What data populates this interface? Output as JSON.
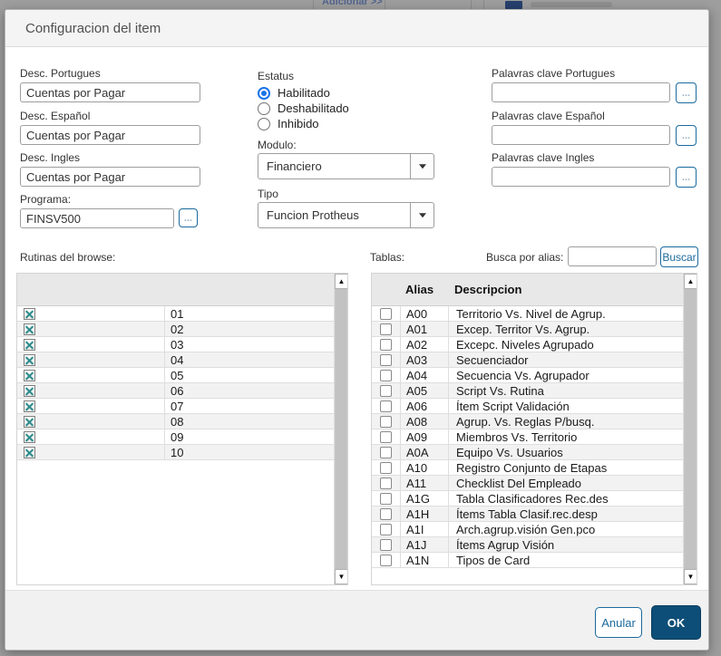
{
  "background_window": {
    "toolbar_button": "Adicionar >>"
  },
  "dialog": {
    "title": "Configuracion del item",
    "fields": {
      "desc_portugues": {
        "label": "Desc. Portugues",
        "value": "Cuentas por Pagar"
      },
      "desc_espanol": {
        "label": "Desc. Español",
        "value": "Cuentas por Pagar"
      },
      "desc_ingles": {
        "label": "Desc. Ingles",
        "value": "Cuentas por Pagar"
      },
      "programa": {
        "label": "Programa:",
        "value": "FINSV500",
        "browse_label": "..."
      },
      "estatus": {
        "label": "Estatus",
        "options": [
          {
            "label": "Habilitado",
            "selected": true
          },
          {
            "label": "Deshabilitado",
            "selected": false
          },
          {
            "label": "Inhibido",
            "selected": false
          }
        ]
      },
      "modulo": {
        "label": "Modulo:",
        "value": "Financiero"
      },
      "tipo": {
        "label": "Tipo",
        "value": "Funcion Protheus"
      },
      "palavras_portugues": {
        "label": "Palavras clave Portugues",
        "value": "",
        "browse_label": "..."
      },
      "palavras_espanol": {
        "label": "Palavras clave Español",
        "value": "",
        "browse_label": "..."
      },
      "palavras_ingles": {
        "label": "Palavras clave Ingles",
        "value": "",
        "browse_label": "..."
      }
    },
    "rutinas": {
      "label": "Rutinas del browse:",
      "rows": [
        "01",
        "02",
        "03",
        "04",
        "05",
        "06",
        "07",
        "08",
        "09",
        "10"
      ]
    },
    "tablas": {
      "label": "Tablas:",
      "search_label": "Busca por alias:",
      "search_value": "",
      "buscar_label": "Buscar",
      "columns": {
        "alias": "Alias",
        "descripcion": "Descripcion"
      },
      "rows": [
        [
          "A00",
          "Territorio Vs. Nivel de Agrup."
        ],
        [
          "A01",
          "Excep. Territor Vs. Agrup."
        ],
        [
          "A02",
          "Excepc. Niveles Agrupado"
        ],
        [
          "A03",
          "Secuenciador"
        ],
        [
          "A04",
          "Secuencia Vs. Agrupador"
        ],
        [
          "A05",
          "Script Vs. Rutina"
        ],
        [
          "A06",
          "Ítem Script Validación"
        ],
        [
          "A08",
          "Agrup. Vs. Reglas P/busq."
        ],
        [
          "A09",
          "Miembros Vs. Territorio"
        ],
        [
          "A0A",
          "Equipo Vs. Usuarios"
        ],
        [
          "A10",
          "Registro Conjunto de Etapas"
        ],
        [
          "A11",
          "Checklist Del Empleado"
        ],
        [
          "A1G",
          "Tabla Clasificadores Rec.des"
        ],
        [
          "A1H",
          "Ítems Tabla Clasif.rec.desp"
        ],
        [
          "A1I",
          "Arch.agrup.visión Gen.pco"
        ],
        [
          "A1J",
          "Ítems Agrup Visión"
        ],
        [
          "A1N",
          "Tipos de Card"
        ]
      ]
    },
    "footer": {
      "anular": "Anular",
      "ok": "OK"
    },
    "colors": {
      "accent": "#1a6a9e",
      "ok_bg": "#0d4e78",
      "radio_selected": "#1a73e8",
      "check_x": "#2b8c8c"
    }
  }
}
